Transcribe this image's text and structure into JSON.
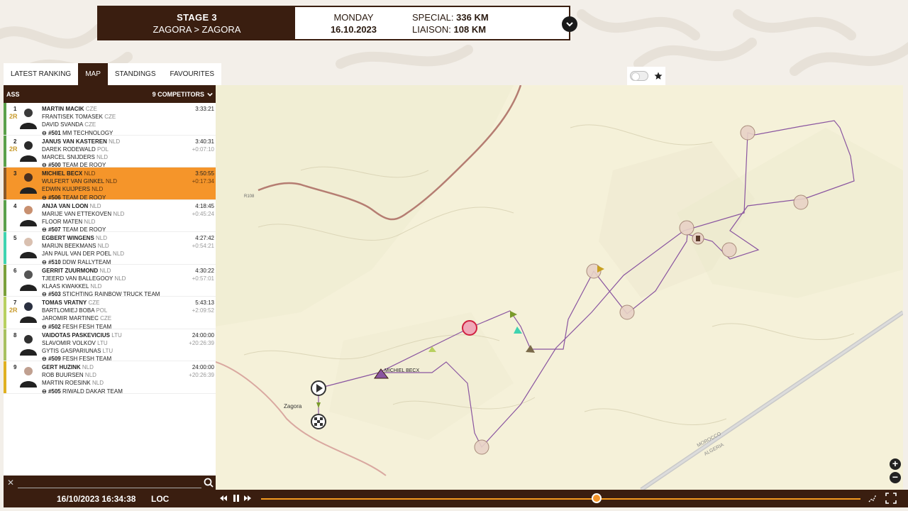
{
  "stage": {
    "title": "STAGE 3",
    "route": "ZAGORA > ZAGORA",
    "day": "MONDAY",
    "date": "16.10.2023",
    "special_label": "SPECIAL:",
    "special_value": "336 KM",
    "liaison_label": "LIAISON:",
    "liaison_value": "108 KM"
  },
  "tabs": [
    "LATEST RANKING",
    "MAP",
    "STANDINGS",
    "FAVOURITES"
  ],
  "panel": {
    "class_label": "ASS",
    "competitors_label": "9 COMPETITORS"
  },
  "rows": [
    {
      "pos": "1",
      "badge": "2R",
      "driver": "MARTIN MACIK",
      "driver_c": "CZE",
      "co1": "FRANTISEK TOMASEK",
      "co1_c": "CZE",
      "co2": "DAVID SVANDA",
      "co2_c": "CZE",
      "num": "#501",
      "team": "MM TECHNOLOGY",
      "time": "3:33:21",
      "gap": "",
      "stripe": "#5aa04a"
    },
    {
      "pos": "2",
      "badge": "2R",
      "driver": "JANUS VAN KASTEREN",
      "driver_c": "NLD",
      "co1": "DAREK RODEWALD",
      "co1_c": "POL",
      "co2": "MARCEL SNIJDERS",
      "co2_c": "NLD",
      "num": "#500",
      "team": "TEAM DE ROOY",
      "time": "3:40:31",
      "gap": "+0:07:10",
      "stripe": "#5aa04a"
    },
    {
      "pos": "3",
      "badge": "",
      "driver": "MICHIEL BECX",
      "driver_c": "NLD",
      "co1": "WULFERT VAN GINKEL",
      "co1_c": "NLD",
      "co2": "EDWIN KUIJPERS",
      "co2_c": "NLD",
      "num": "#506",
      "team": "TEAM DE ROOY",
      "time": "3:50:55",
      "gap": "+0:17:34",
      "stripe": "#8a5a2a"
    },
    {
      "pos": "4",
      "badge": "",
      "driver": "ANJA VAN LOON",
      "driver_c": "NLD",
      "co1": "MARIJE VAN ETTEKOVEN",
      "co1_c": "NLD",
      "co2": "FLOOR MATEN",
      "co2_c": "NLD",
      "num": "#507",
      "team": "TEAM DE ROOY",
      "time": "4:18:45",
      "gap": "+0:45:24",
      "stripe": "#5aa04a"
    },
    {
      "pos": "5",
      "badge": "",
      "driver": "EGBERT WINGENS",
      "driver_c": "NLD",
      "co1": "MARIJN BEEKMANS",
      "co1_c": "NLD",
      "co2": "JAN PAUL VAN DER POEL",
      "co2_c": "NLD",
      "num": "#510",
      "team": "DDW RALLYTEAM",
      "time": "4:27:42",
      "gap": "+0:54:21",
      "stripe": "#3fd3b0"
    },
    {
      "pos": "6",
      "badge": "",
      "driver": "GERRIT ZUURMOND",
      "driver_c": "NLD",
      "co1": "TJEERD VAN BALLEGOOY",
      "co1_c": "NLD",
      "co2": "KLAAS KWAKKEL",
      "co2_c": "NLD",
      "num": "#503",
      "team": "STICHTING RAINBOW TRUCK TEAM",
      "time": "4:30:22",
      "gap": "+0:57:01",
      "stripe": "#7aa03a"
    },
    {
      "pos": "7",
      "badge": "2R",
      "driver": "TOMAS VRATNY",
      "driver_c": "CZE",
      "co1": "BARTLOMIEJ BOBA",
      "co1_c": "POL",
      "co2": "JAROMIR MARTINEC",
      "co2_c": "CZE",
      "num": "#502",
      "team": "FESH FESH TEAM",
      "time": "5:43:13",
      "gap": "+2:09:52",
      "stripe": "#b8d060"
    },
    {
      "pos": "8",
      "badge": "",
      "driver": "VAIDOTAS PASKEVICIUS",
      "driver_c": "LTU",
      "co1": "SLAVOMIR VOLKOV",
      "co1_c": "LTU",
      "co2": "GYTIS GASPARIUNAS",
      "co2_c": "LTU",
      "num": "#509",
      "team": "FESH FESH TEAM",
      "time": "24:00:00",
      "gap": "+20:26:39",
      "stripe": "#a8c060"
    },
    {
      "pos": "9",
      "badge": "",
      "driver": "GERT HUZINK",
      "driver_c": "NLD",
      "co1": "ROB BUURSEN",
      "co1_c": "NLD",
      "co2": "MARTIN ROESINK",
      "co2_c": "NLD",
      "num": "#505",
      "team": "RIWALD DAKAR TEAM",
      "time": "24:00:00",
      "gap": "+20:26:39",
      "stripe": "#e0b020"
    }
  ],
  "map": {
    "town_label": "Zagora",
    "road_label": "R108",
    "vehicle_label": "MICHIEL BECX",
    "border_label_1": "MOROCCO",
    "border_label_2": "ALGERIA"
  },
  "bottom": {
    "clock": "16/10/2023 16:34:38",
    "loc": "LOC",
    "progress": 0.56
  },
  "colors": {
    "brown": "#3a1e10",
    "orange": "#f5952a",
    "route": "#8a55a0"
  }
}
